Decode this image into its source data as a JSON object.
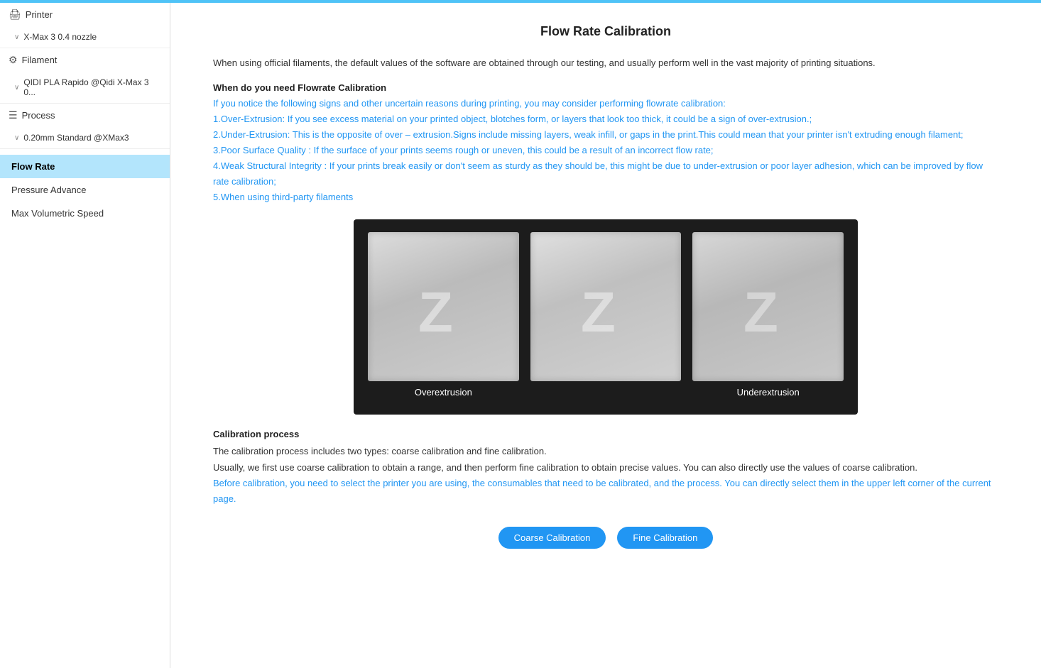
{
  "app": {
    "title": "Flow Rate Calibration"
  },
  "topBar": {
    "color": "#4fc3f7"
  },
  "sidebar": {
    "printer_section": "Printer",
    "printer_value": "X-Max 3 0.4 nozzle",
    "filament_section": "Filament",
    "filament_value": "QIDI PLA Rapido @Qidi X-Max 3 0...",
    "process_section": "Process",
    "process_value": "0.20mm Standard @XMax3",
    "nav_items": [
      {
        "id": "flow-rate",
        "label": "Flow Rate",
        "active": true
      },
      {
        "id": "pressure-advance",
        "label": "Pressure Advance",
        "active": false
      },
      {
        "id": "max-volumetric-speed",
        "label": "Max Volumetric Speed",
        "active": false
      }
    ]
  },
  "content": {
    "page_title": "Flow Rate Calibration",
    "intro": "When using official filaments, the default values of the software are obtained through our testing, and usually perform well in the vast majority of printing situations.",
    "when_title": "When do you need Flowrate Calibration",
    "when_body_intro": "If you notice the following signs and other uncertain reasons during printing, you may consider performing flowrate calibration:",
    "when_items": [
      "1.Over-Extrusion: If you see excess material on your printed object, blotches form, or layers that look too thick, it could be a sign of over-extrusion.;",
      "2.Under-Extrusion: This is the opposite of over – extrusion.Signs include missing layers, weak infill, or gaps in the print.This could mean that your printer isn't extruding enough filament;",
      "3.Poor Surface Quality : If the surface of your prints seems rough or uneven, this could be a result of an incorrect flow rate;",
      "4.Weak Structural Integrity : If your prints break easily or don't seem as sturdy as they should be, this might be due to under-extrusion or poor layer adhesion, which can be improved by flow rate calibration;",
      "5.When using third-party filaments"
    ],
    "image_blocks": [
      {
        "id": "over",
        "label": "Overextrusion"
      },
      {
        "id": "normal",
        "label": ""
      },
      {
        "id": "under",
        "label": "Underextrusion"
      }
    ],
    "calibration_process_title": "Calibration process",
    "calibration_process_line1": "The calibration process includes two types: coarse calibration and fine calibration.",
    "calibration_process_line2": "Usually, we first use coarse calibration to obtain a range, and then perform fine calibration to obtain precise values. You can also directly use the values of coarse calibration.",
    "calibration_process_line3": "Before calibration, you need to select the printer you are using, the consumables that need to be calibrated, and the process. You can directly select them in the upper left corner of the current page.",
    "button_coarse": "Coarse Calibration",
    "button_fine": "Fine Calibration"
  }
}
